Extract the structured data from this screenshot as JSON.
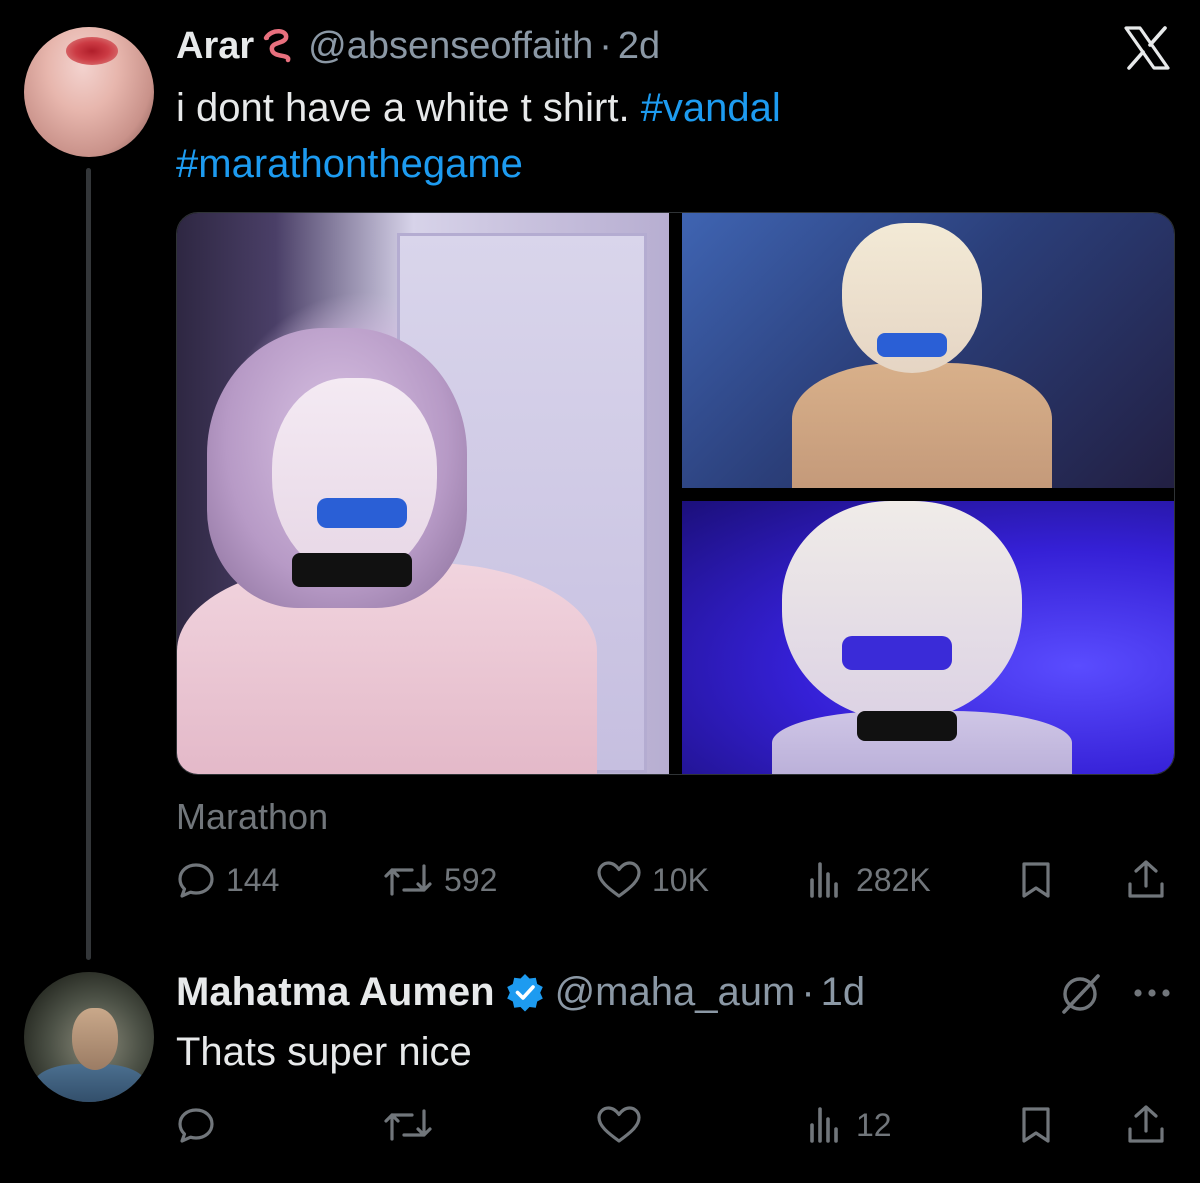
{
  "tweet": {
    "author_name": "Arar",
    "author_handle": "@absenseoffaith",
    "separator": "·",
    "time": "2d",
    "name_emoji_icon": "worm-icon",
    "text": "i dont have a white t shirt. ",
    "hashtags": [
      "#vandal",
      "#marathonthegame"
    ],
    "source_label": "Marathon",
    "stats": {
      "replies": "144",
      "reposts": "592",
      "likes": "10K",
      "views": "282K"
    }
  },
  "reply": {
    "author_name": "Mahatma Aumen",
    "author_handle": "@maha_aum",
    "separator": "·",
    "time": "1d",
    "verified_icon": "verified-badge-icon",
    "text": "Thats super nice",
    "stats": {
      "replies": "",
      "reposts": "",
      "likes": "",
      "views": "12"
    }
  },
  "colors": {
    "background": "#000000",
    "text_primary": "#e7e9ea",
    "text_secondary": "#71767b",
    "link": "#1d9bf0",
    "thread_line": "#333639"
  },
  "icons": {
    "x_logo": "x-logo-icon",
    "reply": "reply-icon",
    "repost": "repost-icon",
    "like": "heart-icon",
    "views": "views-icon",
    "bookmark": "bookmark-icon",
    "share": "share-icon",
    "grok": "grok-icon",
    "more": "more-icon"
  }
}
